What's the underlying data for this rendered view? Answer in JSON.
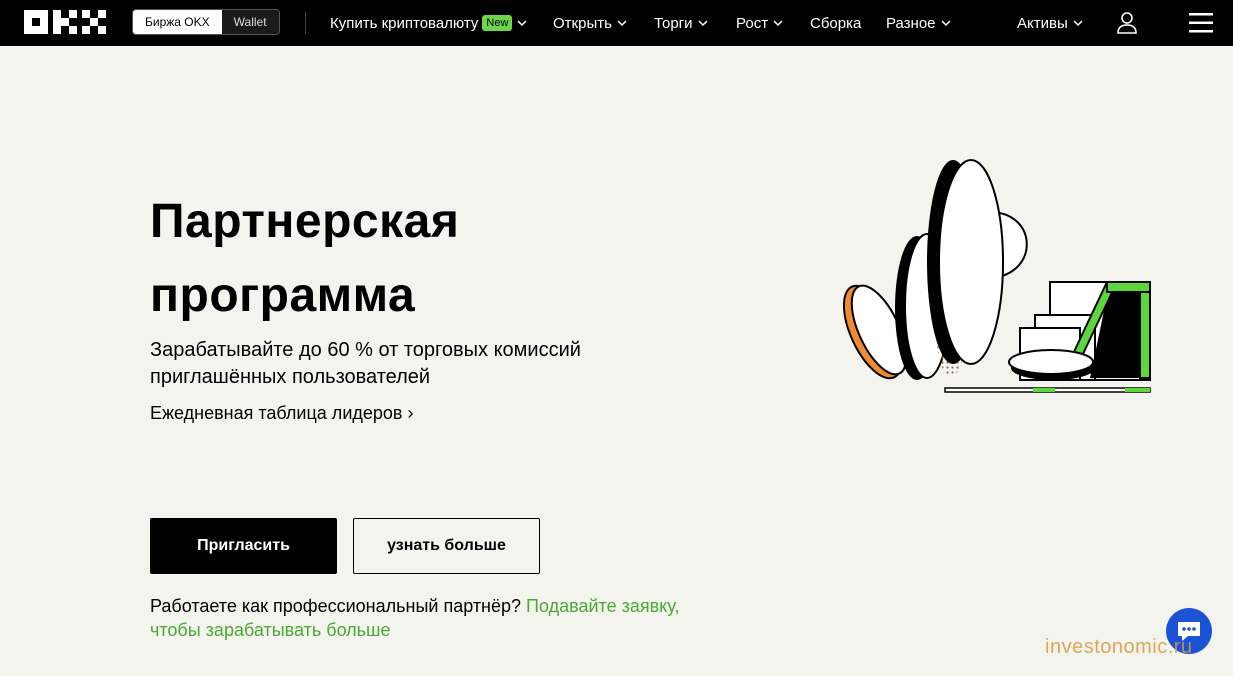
{
  "header": {
    "switch": [
      "Биржа OKX",
      "Wallet"
    ],
    "nav": {
      "buy": "Купить криптовалюту",
      "buy_badge": "New",
      "open": "Открыть",
      "trade": "Торги",
      "grow": "Рост",
      "build": "Сборка",
      "misc": "Разное",
      "assets": "Активы"
    }
  },
  "hero": {
    "title": "Партнерская программа",
    "subtitle": "Зарабатывайте до 60 % от торговых комиссий приглашённых пользователей",
    "leaderboard_link": "Ежедневная таблица лидеров",
    "invite_button": "Пригласить",
    "more_button": "узнать больше",
    "partner_text": "Работаете как профессиональный партнёр?",
    "partner_link": "Подавайте заявку, чтобы зарабатывать больше"
  },
  "watermark": "investonomic.ru",
  "colors": {
    "accent_green": "#4aa834",
    "badge_green": "#6ed64a",
    "chat_blue": "#1c52d6",
    "coin_orange": "#f28a30"
  }
}
